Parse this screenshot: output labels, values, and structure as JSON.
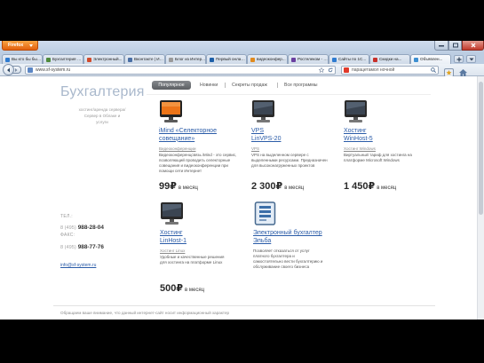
{
  "browser": {
    "app_button": "Firefox",
    "tabs": [
      {
        "label": "Вы кто бы был...",
        "active": false
      },
      {
        "label": "Бухгалтерия О...",
        "active": false
      },
      {
        "label": "Электронный...",
        "active": false
      },
      {
        "label": "Вконтакте | Имп...",
        "active": false
      },
      {
        "label": "Блог из Интер...",
        "active": false
      },
      {
        "label": "Первый онлай...",
        "active": false
      },
      {
        "label": "видеоконфер...",
        "active": false
      },
      {
        "label": "Ростелеком - Гл...",
        "active": false
      },
      {
        "label": "Сайты по 1С...",
        "active": false
      },
      {
        "label": "Скидки на...",
        "active": false
      },
      {
        "label": "Объявлен...",
        "active": true
      }
    ],
    "url": "www.sf-system.ru",
    "search_value": "парацетамол ночной"
  },
  "site": {
    "menu": [
      {
        "label": "Популярное",
        "active": true
      },
      {
        "label": "Новинки",
        "active": false
      },
      {
        "label": "Секреты продаж",
        "active": false
      },
      {
        "label": "Все программы",
        "active": false
      }
    ],
    "section_title": "Бухгалтерия",
    "section_subtitle": [
      "хостинг/аренда сервера/",
      "Сервер в Облаке и",
      "услуги"
    ],
    "contacts": {
      "phone_label": "ТЕЛ.:",
      "phone_prefix": "8 (495)",
      "phone_number": "988-28-04",
      "fax_label": "ФАКС:",
      "fax_prefix": "8 (495)",
      "fax_number": "988-77-76",
      "email": "info@sf-system.ru"
    },
    "products": [
      {
        "icon": "monitor-orange-icon",
        "title": [
          "iMind «Селекторное",
          "совещание»"
        ],
        "category": "Видеоконференции",
        "description": "Видеоконференцсвязь iMind - это сервис, позволяющий проводить селекторные совещания и видеоконференции при помощи сети Интернет",
        "price": "99₽",
        "price_unit": "в месяц"
      },
      {
        "icon": "monitor-icon",
        "title": [
          "VPS",
          "LinVPS-20"
        ],
        "category": "VPS",
        "description": "VPS на выделенном сервере с выделенными ресурсами. Предназначен для высоконагруженных проектов",
        "price": "2 300₽",
        "price_unit": "в месяц"
      },
      {
        "icon": "monitor-icon",
        "title": [
          "Хостинг",
          "WinHost-5"
        ],
        "category": "Хостинг Windows",
        "description": "Виртуальный тариф для хостинга на платформе Microsoft Windows",
        "price": "1 450₽",
        "price_unit": "в месяц"
      },
      {
        "icon": "monitor-icon",
        "title": [
          "Хостинг",
          "LinHost-1"
        ],
        "category": "Хостинг Linux",
        "description": "Удобные и качественные решения для хостинга на платформе Linux",
        "price": "500₽",
        "price_unit": "в месяц"
      },
      {
        "icon": "accounting-app-icon",
        "title": [
          "Электронный бухгалтер",
          "Эльба"
        ],
        "description": "Позволяет отказаться от услуг платного бухгалтера и самостоятельно вести бухгалтерию и обслуживание своего бизнеса"
      }
    ],
    "footer_note": "Обращаем ваше внимание, что данный интернет-сайт носит информационный характер"
  },
  "colors": {
    "firefox_button": "#e3600e",
    "link": "#2b5ca8",
    "menu_active_bg": "#6e7175",
    "section_title": "#a9b8cc",
    "window_close": "#c1392b"
  }
}
